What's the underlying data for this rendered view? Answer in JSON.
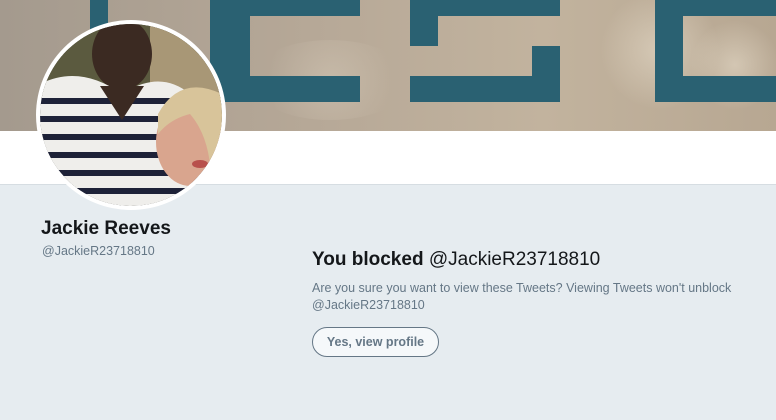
{
  "profile": {
    "name": "Jackie Reeves",
    "handle": "@JackieR23718810"
  },
  "blocked": {
    "title_prefix": "You blocked",
    "title_handle": "@JackieR23718810",
    "description": "Are you sure you want to view these Tweets? Viewing Tweets won't unblock @JackieR23718810",
    "button_label": "Yes, view profile"
  },
  "colors": {
    "page_background": "#e6ecf0",
    "primary_text": "#14171a",
    "secondary_text": "#657786",
    "banner_letters": "#2a6172"
  }
}
